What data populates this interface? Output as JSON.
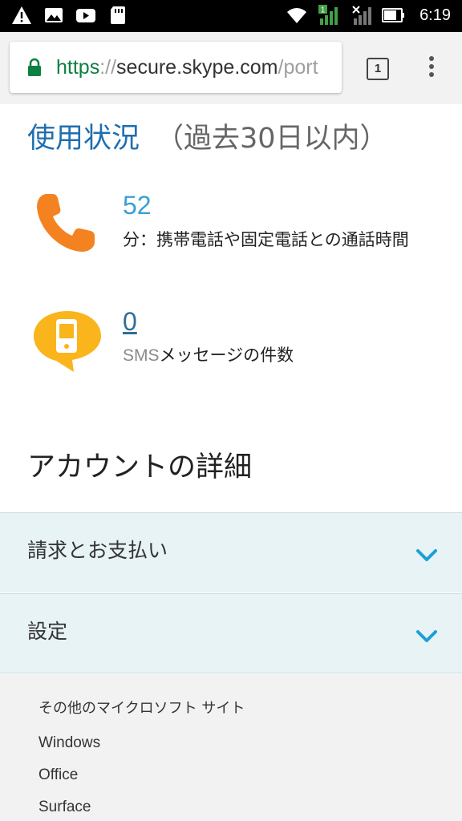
{
  "status_bar": {
    "time": "6:19",
    "sim_badge": "1",
    "icons": [
      "warning-icon",
      "image-icon",
      "youtube-icon",
      "sd-card-icon",
      "wifi-icon",
      "signal-icon",
      "battery-icon"
    ]
  },
  "browser": {
    "url_scheme": "https",
    "url_sep": "://",
    "url_host": "secure.skype.com",
    "url_path": "/port",
    "tab_count": "1"
  },
  "usage": {
    "title": "使用状況",
    "subtitle": "（過去30日以内）",
    "calls_value": "52",
    "calls_label": "分：携帯電話や固定電話との通話時間",
    "sms_value": "0",
    "sms_label_prefix": "SMS",
    "sms_label_suffix": "メッセージの件数"
  },
  "account": {
    "title": "アカウントの詳細",
    "sections": [
      "請求とお支払い",
      "設定"
    ]
  },
  "footer": {
    "heading": "その他のマイクロソフト サイト",
    "links": [
      "Windows",
      "Office",
      "Surface"
    ]
  },
  "colors": {
    "accent_blue": "#1f6fb0",
    "value_blue": "#3a9fd4",
    "chevron_blue": "#1aa0d8",
    "phone_orange": "#f58220",
    "sms_yellow": "#f9b51b",
    "secure_green": "#0b8043"
  }
}
